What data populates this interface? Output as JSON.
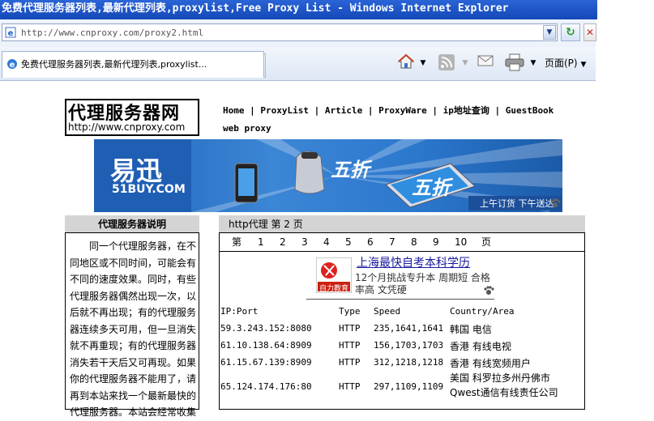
{
  "window": {
    "title": "免费代理服务器列表,最新代理列表,proxylist,Free Proxy List - Windows Internet Explorer"
  },
  "address_bar": {
    "url": "http://www.cnproxy.com/proxy2.html"
  },
  "tab": {
    "label": "免费代理服务器列表,最新代理列表,proxylist..."
  },
  "toolbar": {
    "page_menu_label": "页面(P)",
    "home_icon": "home-icon",
    "rss_icon": "rss-icon",
    "mail_icon": "mail-icon",
    "print_icon": "print-icon"
  },
  "site": {
    "logo_text": "代理服务器网",
    "logo_url": "http://www.cnproxy.com",
    "nav": [
      "Home",
      "ProxyList",
      "Article",
      "ProxyWare",
      "ip地址查询",
      "GuestBook"
    ],
    "nav_second": "web proxy"
  },
  "banner": {
    "brand": "易迅",
    "brand_sub": "51BUY.COM",
    "discount_1": "五折",
    "discount_2": "五折",
    "slogan": "上午订货 下午送达"
  },
  "left_box": {
    "title": "代理服务器说明",
    "body": "同一个代理服务器，在不同地区或不同时间，可能会有不同的速度效果。同时，有些代理服务器偶然出现一次，以后就不再出现；有的代理服务器连续多天可用，但一旦消失就不再重现；有的代理服务器消失若干天后又可再现。如果你的代理服务器不能用了，请再到本站来找一个最新最快的代理服务器。本站会经常收集"
  },
  "right_box": {
    "title": "http代理 第 2 页",
    "pager_prefix": "第",
    "pages": [
      "1",
      "2",
      "3",
      "4",
      "5",
      "6",
      "7",
      "8",
      "9",
      "10"
    ],
    "pager_suffix": "页",
    "ad": {
      "logo_text": "自力教育",
      "title": "上海最快自考本科学历",
      "line1": "12个月挑战专升本 周期短 合格",
      "line2": "率高 文凭硬"
    },
    "columns": [
      "IP:Port",
      "Type",
      "Speed",
      "Country/Area"
    ],
    "rows": [
      {
        "ip": "59.3.243.152:8080",
        "type": "HTTP",
        "speed": "235,1641,1641",
        "area": "韩国 电信"
      },
      {
        "ip": "61.10.138.64:8909",
        "type": "HTTP",
        "speed": "156,1703,1703",
        "area": "香港 有线电视"
      },
      {
        "ip": "61.15.67.139:8909",
        "type": "HTTP",
        "speed": "312,1218,1218",
        "area": "香港 有线宽频用户"
      },
      {
        "ip": "65.124.174.176:80",
        "type": "HTTP",
        "speed": "297,1109,1109",
        "area": "美国 科罗拉多州丹佛市Qwest通信有线责任公司"
      }
    ]
  },
  "colors": {
    "titlebar": "#1448b8",
    "box_header": "#d4d4d4",
    "banner_blue": "#2b77cc",
    "link": "#1a1aa0"
  }
}
